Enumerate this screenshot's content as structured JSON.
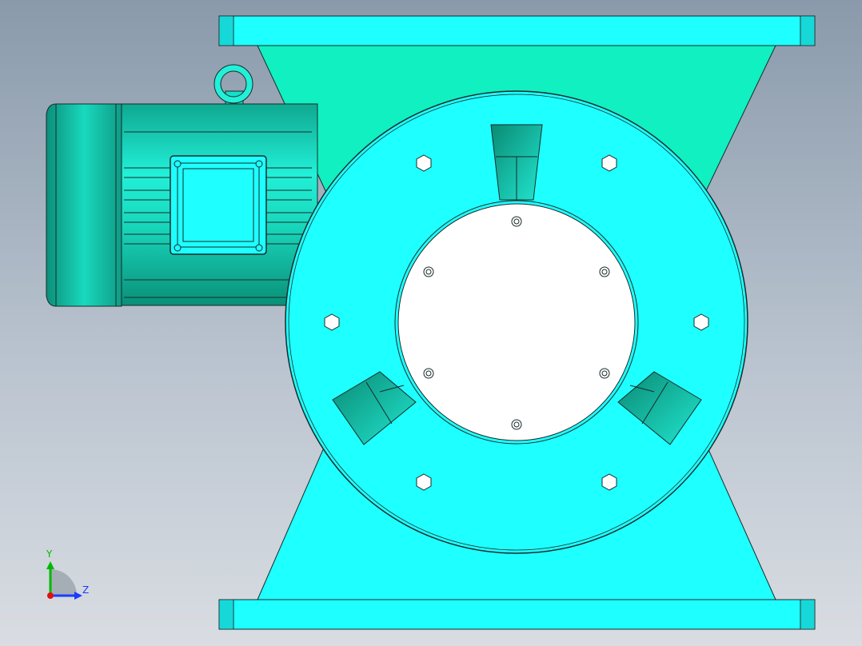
{
  "viewport": {
    "background_top": "#8a9aab",
    "background_bottom": "#d9dde2"
  },
  "model": {
    "body_color": "#1effff",
    "hopper_color": "#10f0c0",
    "motor_color": "#14e0c8",
    "shade_color": "#0a9a85",
    "outline_color": "#1a2a2a",
    "rotor_face_color": "#ffffff"
  },
  "triad": {
    "y_label": "Y",
    "z_label": "Z",
    "y_color": "#00b800",
    "z_color": "#1a3cff",
    "x_color": "#e01010"
  }
}
